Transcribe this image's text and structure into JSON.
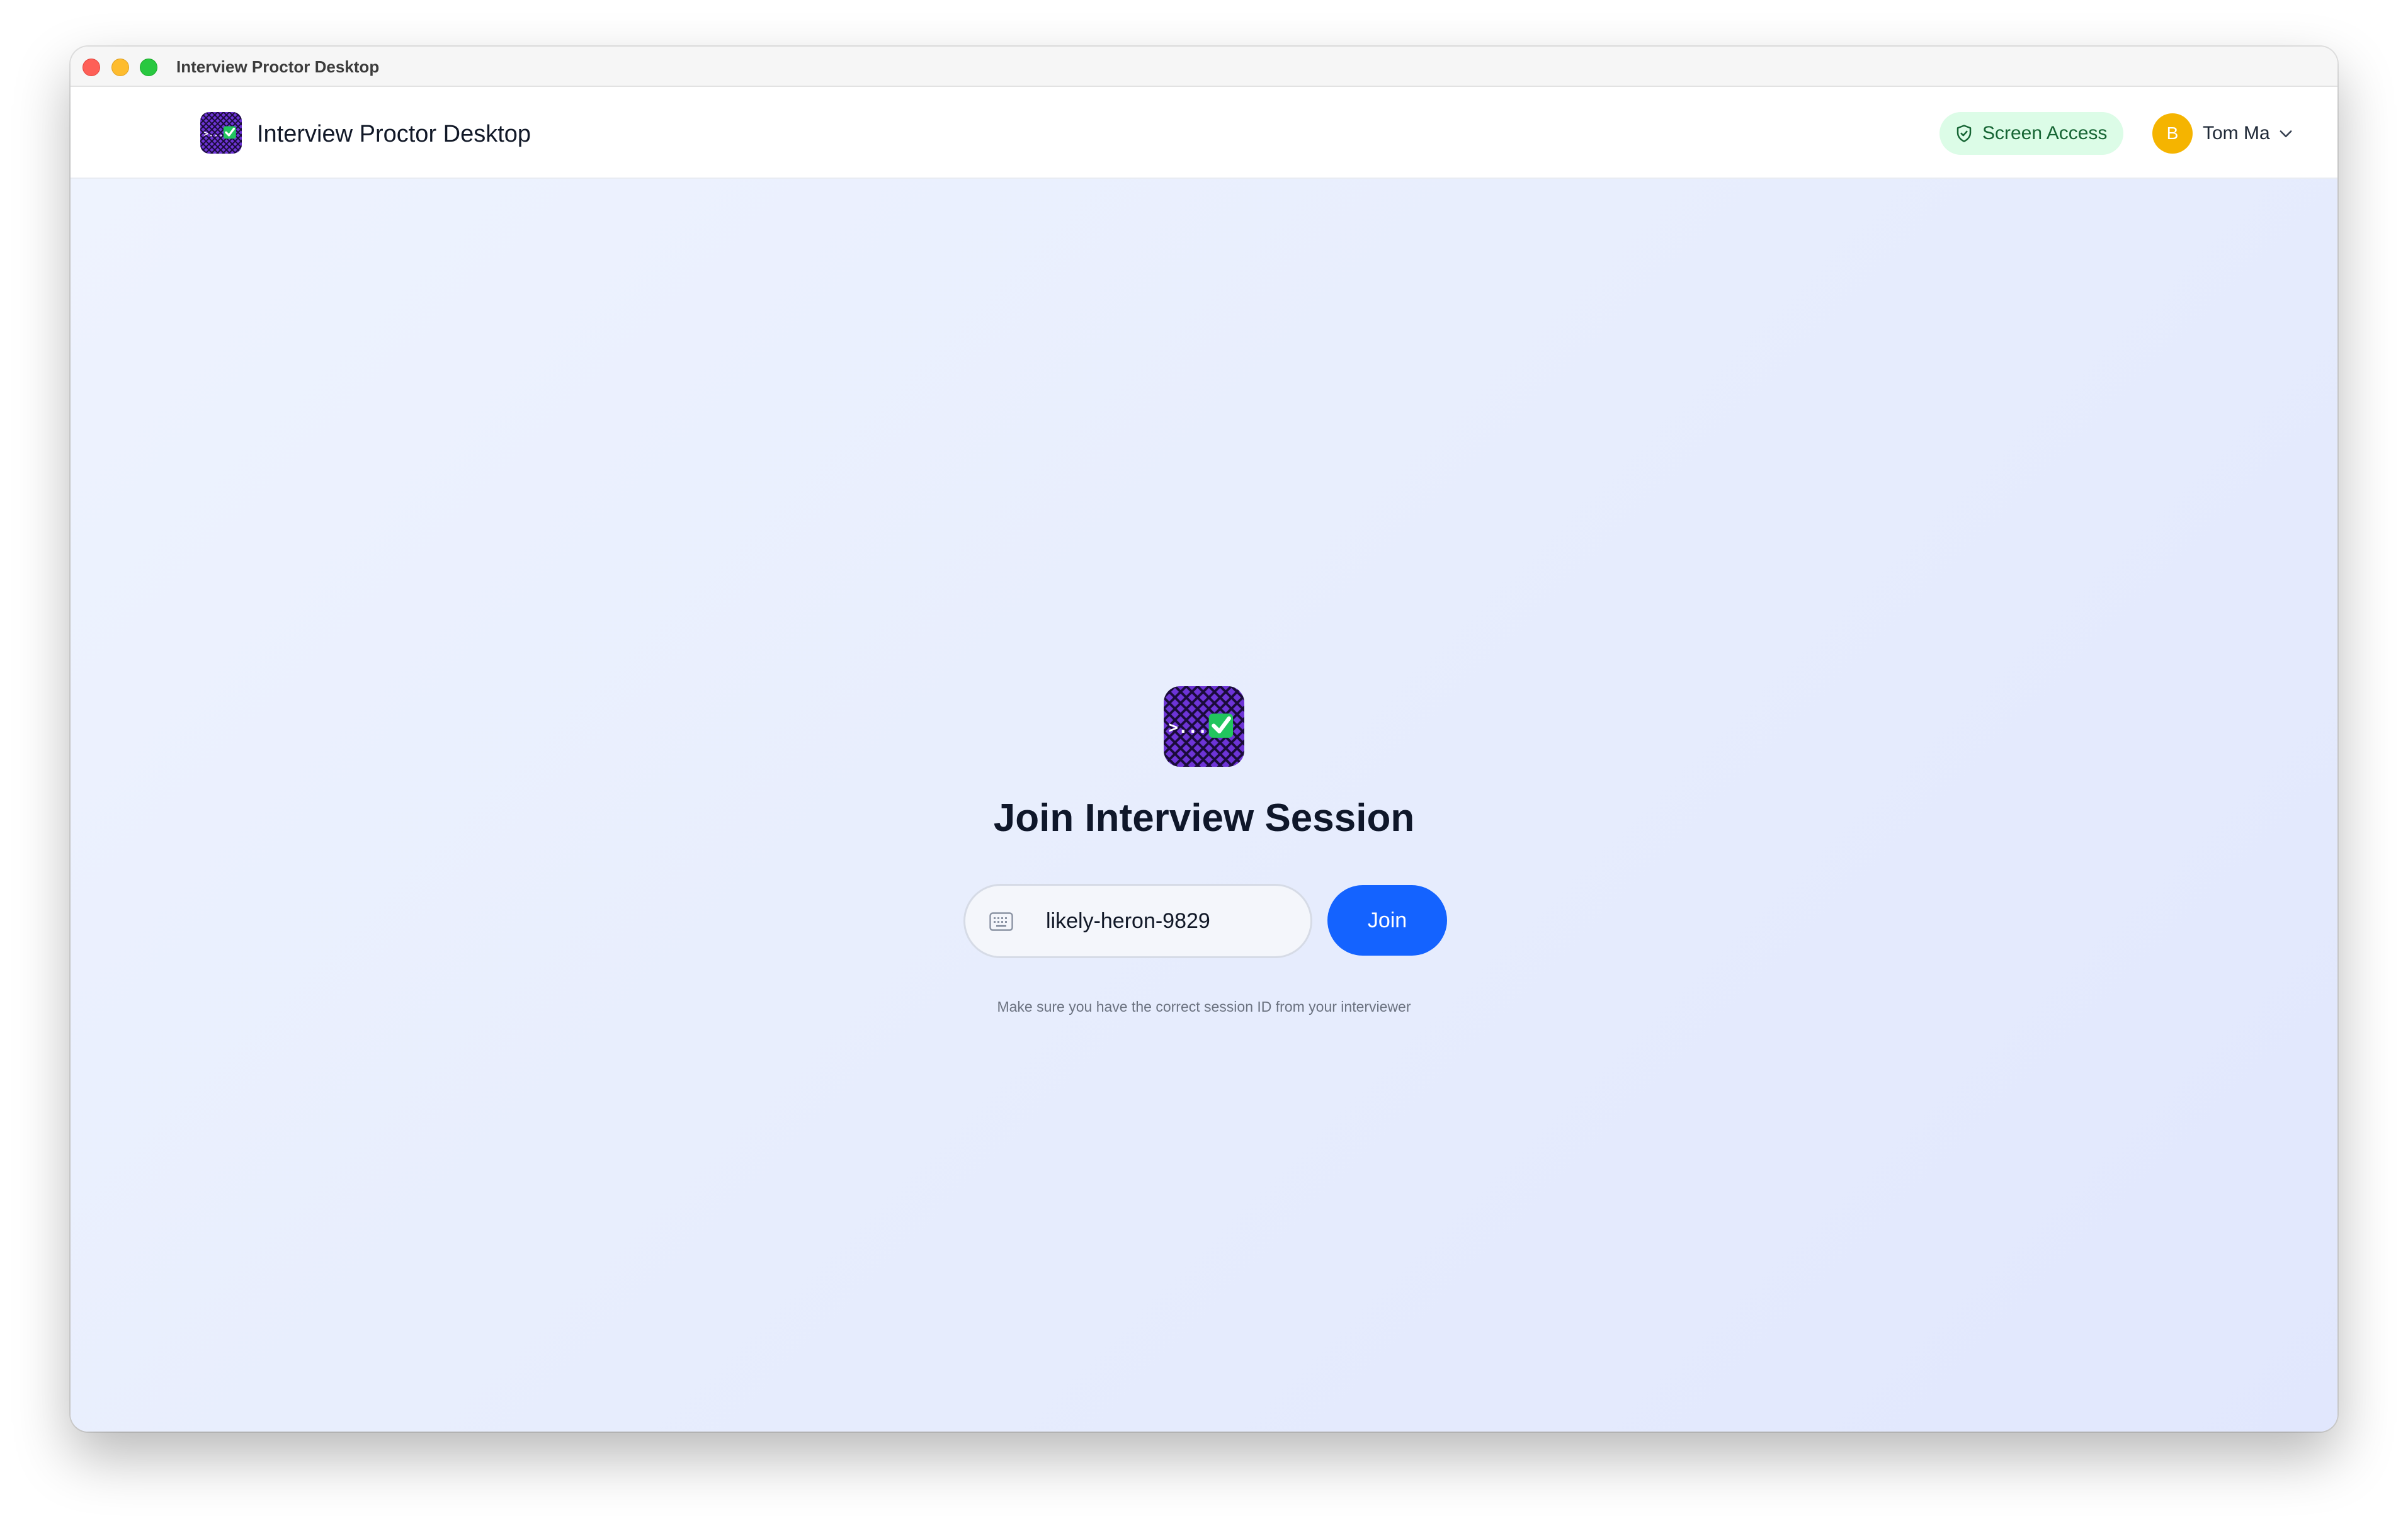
{
  "window": {
    "title": "Interview Proctor Desktop"
  },
  "header": {
    "app_name": "Interview Proctor Desktop",
    "screen_access_label": "Screen Access",
    "user": {
      "avatar_initial": "B",
      "name": "Tom Ma"
    }
  },
  "main": {
    "heading": "Join Interview Session",
    "session_input_value": "likely-heron-9829",
    "join_label": "Join",
    "hint": "Make sure you have the correct session ID from your interviewer"
  },
  "icons": {
    "app_logo": "app-logo-icon",
    "screen_access": "shield-check-icon",
    "user_menu": "chevron-down-icon",
    "session_input": "keyboard-icon"
  },
  "colors": {
    "accent": "#1463ff",
    "logo_purple": "#6d34d6",
    "check_green": "#22c55e",
    "badge_bg": "#dcfce7",
    "badge_text": "#166534",
    "avatar_bg": "#f5b400"
  }
}
